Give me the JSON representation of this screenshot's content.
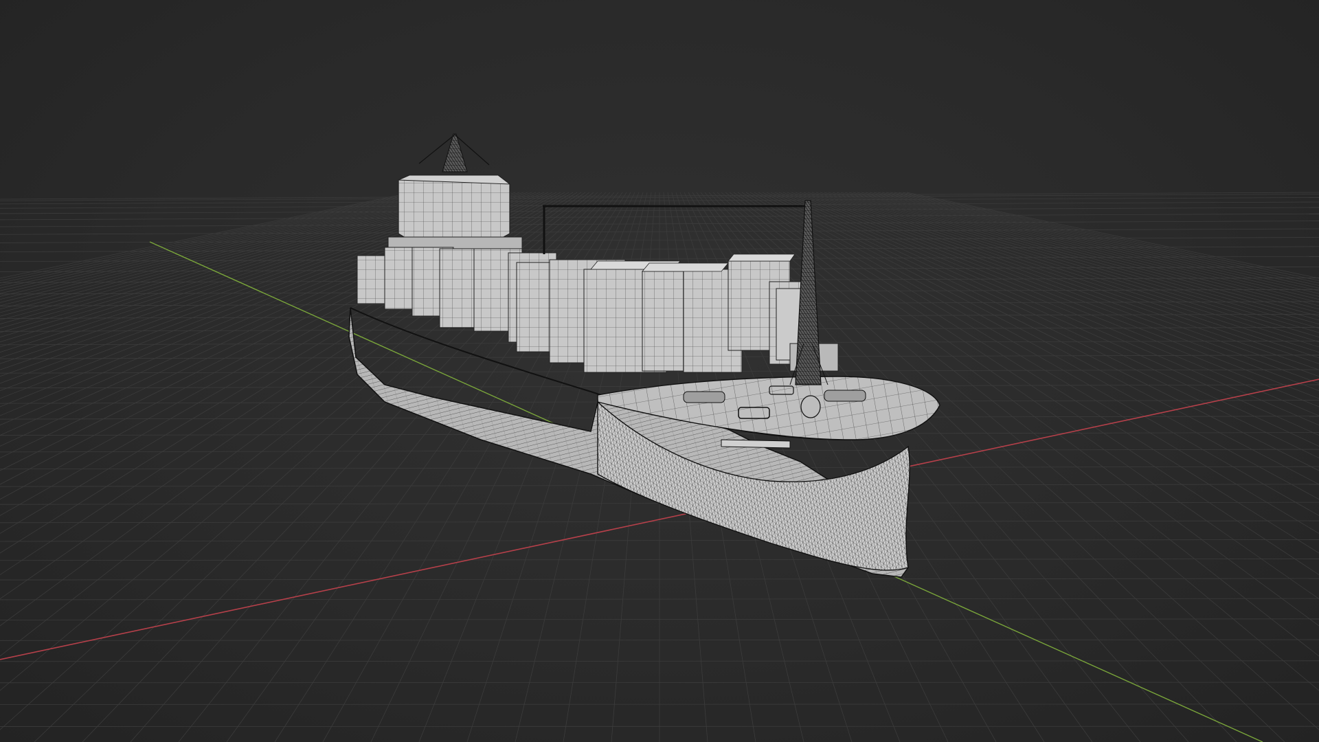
{
  "viewport": {
    "background": "#2b2b2b",
    "grid_color": "#3c3c3c",
    "x_axis_color": "#b6404a",
    "y_axis_color": "#7aa63a"
  },
  "scene": {
    "object": "container-ship-wireframe",
    "hull_color": "#bdbdbd",
    "wire_color": "#1b1b1b",
    "container_color": "#c9c9c9",
    "icons": [
      "grid-floor",
      "x-axis-line",
      "y-axis-line"
    ]
  }
}
